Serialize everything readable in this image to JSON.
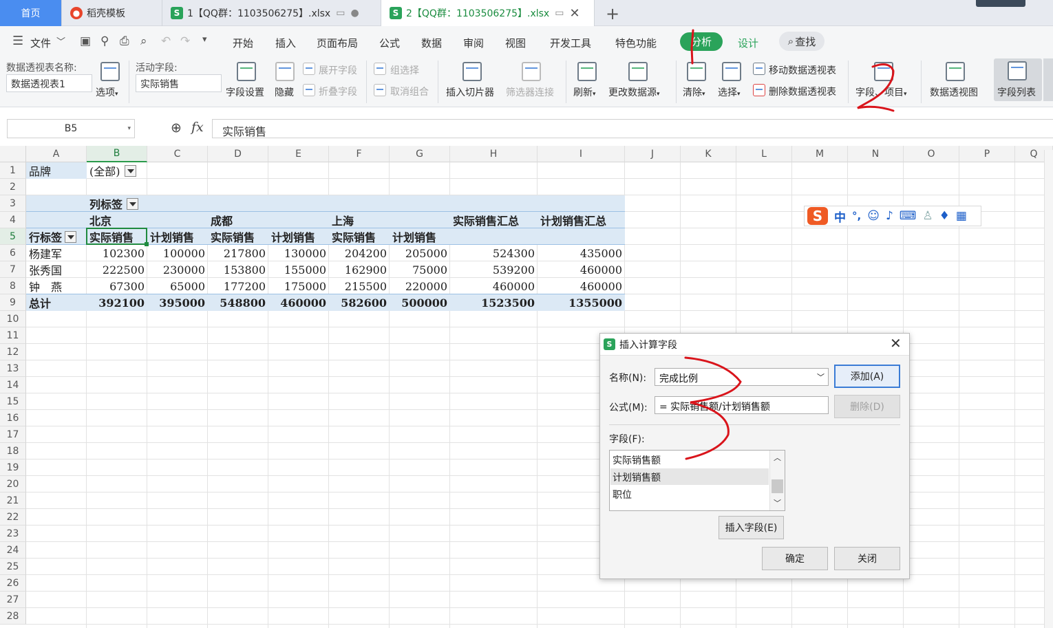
{
  "tabs": {
    "home": "首页",
    "template": "稻壳模板",
    "file1": "1【QQ群：1103506275】.xlsx",
    "file2": "2【QQ群：1103506275】.xlsx",
    "new_tab": "+"
  },
  "menu": {
    "file": "文件",
    "items": [
      "开始",
      "插入",
      "页面布局",
      "公式",
      "数据",
      "审阅",
      "视图",
      "开发工具",
      "特色功能",
      "分析",
      "设计"
    ],
    "search": "查找"
  },
  "ribbon": {
    "pivot_name_label": "数据透视表名称:",
    "pivot_name_value": "数据透视表1",
    "options": "选项",
    "active_field_label": "活动字段:",
    "active_field_value": "实际销售",
    "field_settings": "字段设置",
    "hide": "隐藏",
    "expand_field": "展开字段",
    "collapse_field": "折叠字段",
    "group_selection": "组选择",
    "ungroup": "取消组合",
    "insert_slicer": "插入切片器",
    "filter_connections": "筛选器连接",
    "refresh": "刷新",
    "change_source": "更改数据源",
    "clear": "清除",
    "select": "选择",
    "move_pivot": "移动数据透视表",
    "delete_pivot": "删除数据透视表",
    "field": "字段、项目",
    "pivot_chart": "数据透视图",
    "field_list": "字段列表"
  },
  "formula_bar": {
    "cell_ref": "B5",
    "fx": "fx",
    "value": "实际销售"
  },
  "columns": [
    "A",
    "B",
    "C",
    "D",
    "E",
    "F",
    "G",
    "H",
    "I",
    "J",
    "K",
    "L",
    "M",
    "N",
    "O",
    "P",
    "Q"
  ],
  "rows": [
    "1",
    "2",
    "3",
    "4",
    "5",
    "6",
    "7",
    "8",
    "9",
    "10",
    "11",
    "12",
    "13",
    "14",
    "15",
    "16",
    "17",
    "18",
    "19",
    "20",
    "21",
    "22",
    "23",
    "24",
    "25",
    "26",
    "27",
    "28"
  ],
  "pivot": {
    "filter_label": "品牌",
    "filter_value": "(全部)",
    "col_labels": "列标签",
    "row_labels": "行标签",
    "cities": [
      "北京",
      "成都",
      "上海"
    ],
    "total_actual": "实际销售汇总",
    "total_plan": "计划销售汇总",
    "measures": [
      "实际销售",
      "计划销售",
      "实际销售",
      "计划销售",
      "实际销售",
      "计划销售"
    ],
    "data": [
      {
        "name": "杨建军",
        "values": [
          "102300",
          "100000",
          "217800",
          "130000",
          "204200",
          "205000",
          "524300",
          "435000"
        ]
      },
      {
        "name": "张秀国",
        "values": [
          "222500",
          "230000",
          "153800",
          "155000",
          "162900",
          "75000",
          "539200",
          "460000"
        ]
      },
      {
        "name": "钟　燕",
        "values": [
          "67300",
          "65000",
          "177200",
          "175000",
          "215500",
          "220000",
          "460000",
          "460000"
        ]
      }
    ],
    "grand_total": {
      "name": "总计",
      "values": [
        "392100",
        "395000",
        "548800",
        "460000",
        "582600",
        "500000",
        "1523500",
        "1355000"
      ]
    }
  },
  "ime": {
    "logo": "S",
    "chinese": "中",
    "punct": "°,"
  },
  "dialog": {
    "title": "插入计算字段",
    "name_label": "名称(N):",
    "name_value": "完成比例",
    "add": "添加(A)",
    "formula_label": "公式(M):",
    "formula_value": "= 实际销售额/计划销售额",
    "delete": "删除(D)",
    "fields_label": "字段(F):",
    "fields": [
      "实际销售额",
      "计划销售额",
      "职位"
    ],
    "insert_field": "插入字段(E)",
    "ok": "确定",
    "close": "关闭"
  },
  "colors": {
    "accent_green": "#1a8c3f",
    "pivot_band": "#dce9f5",
    "home_tab": "#4a8df0",
    "annotation_red": "#d9141b"
  }
}
